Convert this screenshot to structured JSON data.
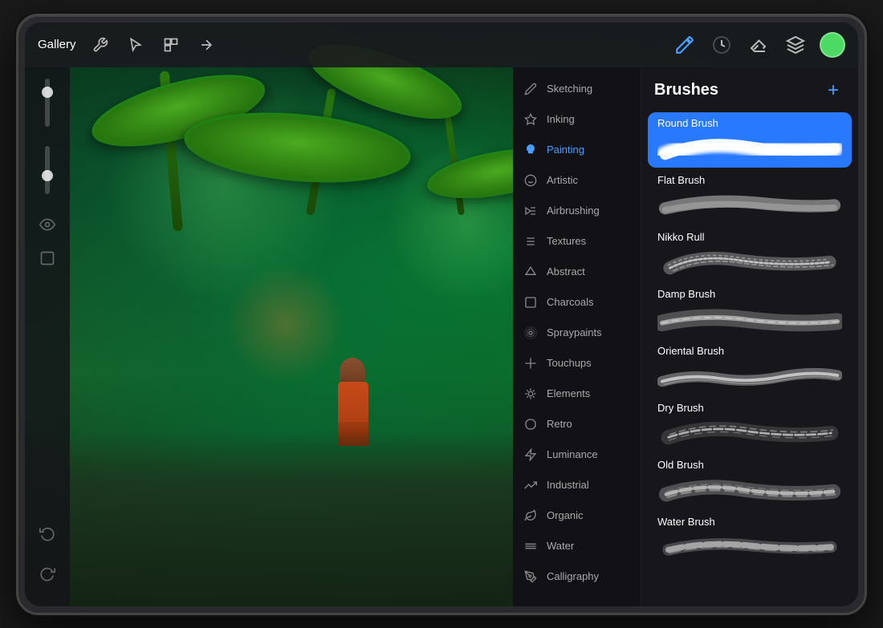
{
  "toolbar": {
    "gallery_label": "Gallery",
    "add_label": "+",
    "color": "#4cd964"
  },
  "brushes_panel": {
    "title": "Brushes",
    "add_label": "+",
    "categories": [
      {
        "id": "sketching",
        "label": "Sketching",
        "icon": "pencil"
      },
      {
        "id": "inking",
        "label": "Inking",
        "icon": "ink"
      },
      {
        "id": "painting",
        "label": "Painting",
        "icon": "drop",
        "active": true
      },
      {
        "id": "artistic",
        "label": "Artistic",
        "icon": "art"
      },
      {
        "id": "airbrushing",
        "label": "Airbrushing",
        "icon": "air"
      },
      {
        "id": "textures",
        "label": "Textures",
        "icon": "texture"
      },
      {
        "id": "abstract",
        "label": "Abstract",
        "icon": "abstract"
      },
      {
        "id": "charcoals",
        "label": "Charcoals",
        "icon": "charcoal"
      },
      {
        "id": "spraypaints",
        "label": "Spraypaints",
        "icon": "spray"
      },
      {
        "id": "touchups",
        "label": "Touchups",
        "icon": "touchup"
      },
      {
        "id": "elements",
        "label": "Elements",
        "icon": "element"
      },
      {
        "id": "retro",
        "label": "Retro",
        "icon": "retro"
      },
      {
        "id": "luminance",
        "label": "Luminance",
        "icon": "luminance"
      },
      {
        "id": "industrial",
        "label": "Industrial",
        "icon": "industrial"
      },
      {
        "id": "organic",
        "label": "Organic",
        "icon": "organic"
      },
      {
        "id": "water",
        "label": "Water",
        "icon": "water"
      },
      {
        "id": "calligraphy",
        "label": "Calligraphy",
        "icon": "calligraphy"
      }
    ],
    "brushes": [
      {
        "id": "round-brush",
        "name": "Round Brush",
        "selected": true
      },
      {
        "id": "flat-brush",
        "name": "Flat Brush",
        "selected": false
      },
      {
        "id": "nikko-rull",
        "name": "Nikko Rull",
        "selected": false
      },
      {
        "id": "damp-brush",
        "name": "Damp Brush",
        "selected": false
      },
      {
        "id": "oriental-brush",
        "name": "Oriental Brush",
        "selected": false
      },
      {
        "id": "dry-brush",
        "name": "Dry Brush",
        "selected": false
      },
      {
        "id": "old-brush",
        "name": "Old Brush",
        "selected": false
      },
      {
        "id": "water-brush",
        "name": "Water Brush",
        "selected": false
      }
    ]
  }
}
